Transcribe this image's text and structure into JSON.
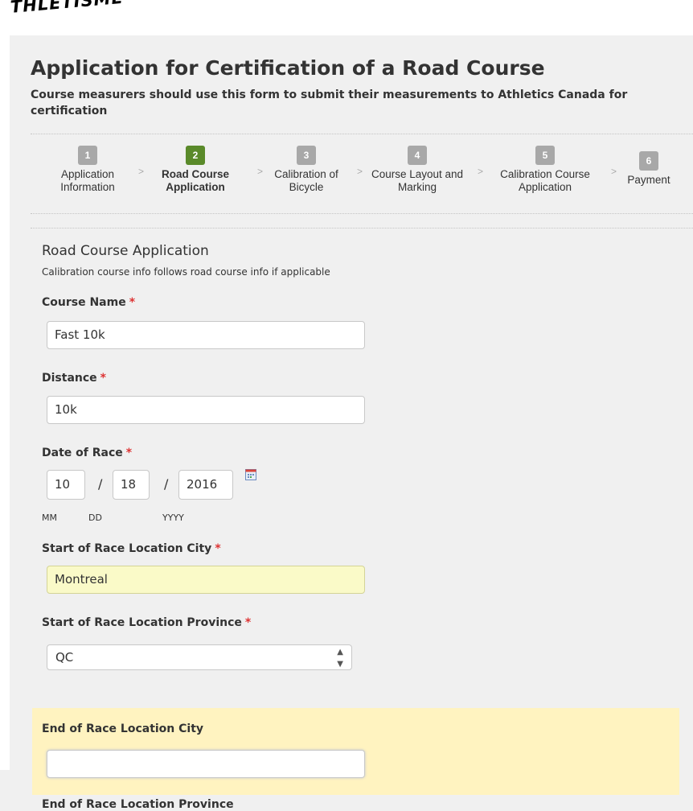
{
  "logo": {
    "text": "THLÉTISME"
  },
  "page": {
    "title": "Application for Certification of a Road Course",
    "subtitle": "Course measurers should use this form to submit their measurements to Athletics Canada for certification"
  },
  "steps": [
    {
      "num": "1",
      "line1": "Application",
      "line2": "Information"
    },
    {
      "num": "2",
      "line1": "Road Course",
      "line2": "Application",
      "active": true
    },
    {
      "num": "3",
      "line1": "Calibration of",
      "line2": "Bicycle"
    },
    {
      "num": "4",
      "line1": "Course Layout and",
      "line2": "Marking"
    },
    {
      "num": "5",
      "line1": "Calibration Course",
      "line2": "Application"
    },
    {
      "num": "6",
      "line1": "Payment",
      "line2": ""
    }
  ],
  "separator": ">",
  "section": {
    "title": "Road Course Application",
    "subtitle": "Calibration course info follows road course info if applicable"
  },
  "required_mark": "*",
  "fields": {
    "course_name": {
      "label": "Course Name",
      "value": "Fast 10k"
    },
    "distance": {
      "label": "Distance",
      "value": "10k"
    },
    "date_of_race": {
      "label": "Date of Race",
      "month": "10",
      "day": "18",
      "year": "2016",
      "month_label": "MM",
      "day_label": "DD",
      "year_label": "YYYY",
      "separator": "/"
    },
    "start_city": {
      "label": "Start of Race Location City",
      "value": "Montreal"
    },
    "start_province": {
      "label": "Start of Race Location Province",
      "value": "QC"
    },
    "end_city": {
      "label": "End of Race Location City",
      "value": ""
    },
    "end_province": {
      "label": "End of Race Location Province"
    }
  },
  "icons": {
    "calendar": "calendar-icon",
    "select_arrows": "up-down-arrows-icon"
  },
  "colors": {
    "step_active": "#5a8a2a",
    "step_inactive": "#a8a8a8",
    "required": "#dd3333",
    "highlight_bg": "#fff3c0",
    "filled_input_bg": "#fafac8"
  }
}
